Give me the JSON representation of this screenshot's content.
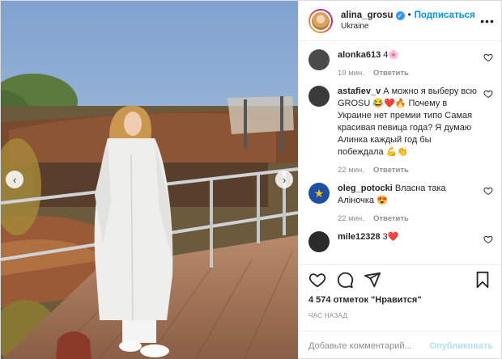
{
  "header": {
    "username": "alina_grosu",
    "separator": "•",
    "follow_label": "Подписаться",
    "location": "Ukraine",
    "more_glyph": "•••"
  },
  "photo": {
    "prev_glyph": "‹",
    "next_glyph": "›"
  },
  "comments": [
    {
      "user": "alonka613",
      "text": "4🌸",
      "time": "19 мин.",
      "reply": "Ответить",
      "avatar_color": "#4a4a4a"
    },
    {
      "user": "astafiev_v",
      "text": "А можно я выберу всю GROSU 😂❤️🔥 Почему в Украине нет премии типо Самая красивая певица года? Я думаю Алинка каждый год бы побеждала 💪👏",
      "time": "22 мин.",
      "reply": "Ответить",
      "avatar_color": "#3b3b3b"
    },
    {
      "user": "oleg_potocki",
      "text": "Власна така Аліночка 😍",
      "time": "22 мин.",
      "reply": "Ответить",
      "avatar_color": "#1f4fa0"
    },
    {
      "user": "mile12328",
      "text": "3❤️",
      "time": "",
      "reply": "",
      "avatar_color": "#2b2b2b"
    }
  ],
  "footer": {
    "likes": "4 574 отметок \"Нравится\"",
    "time_ago": "ЧАС НАЗАД",
    "comment_placeholder": "Добавьте комментарий...",
    "publish_label": "Опубликовать"
  },
  "colors": {
    "accent": "#0095f6",
    "verified": "#3897f0",
    "muted": "#8e8e8e"
  }
}
